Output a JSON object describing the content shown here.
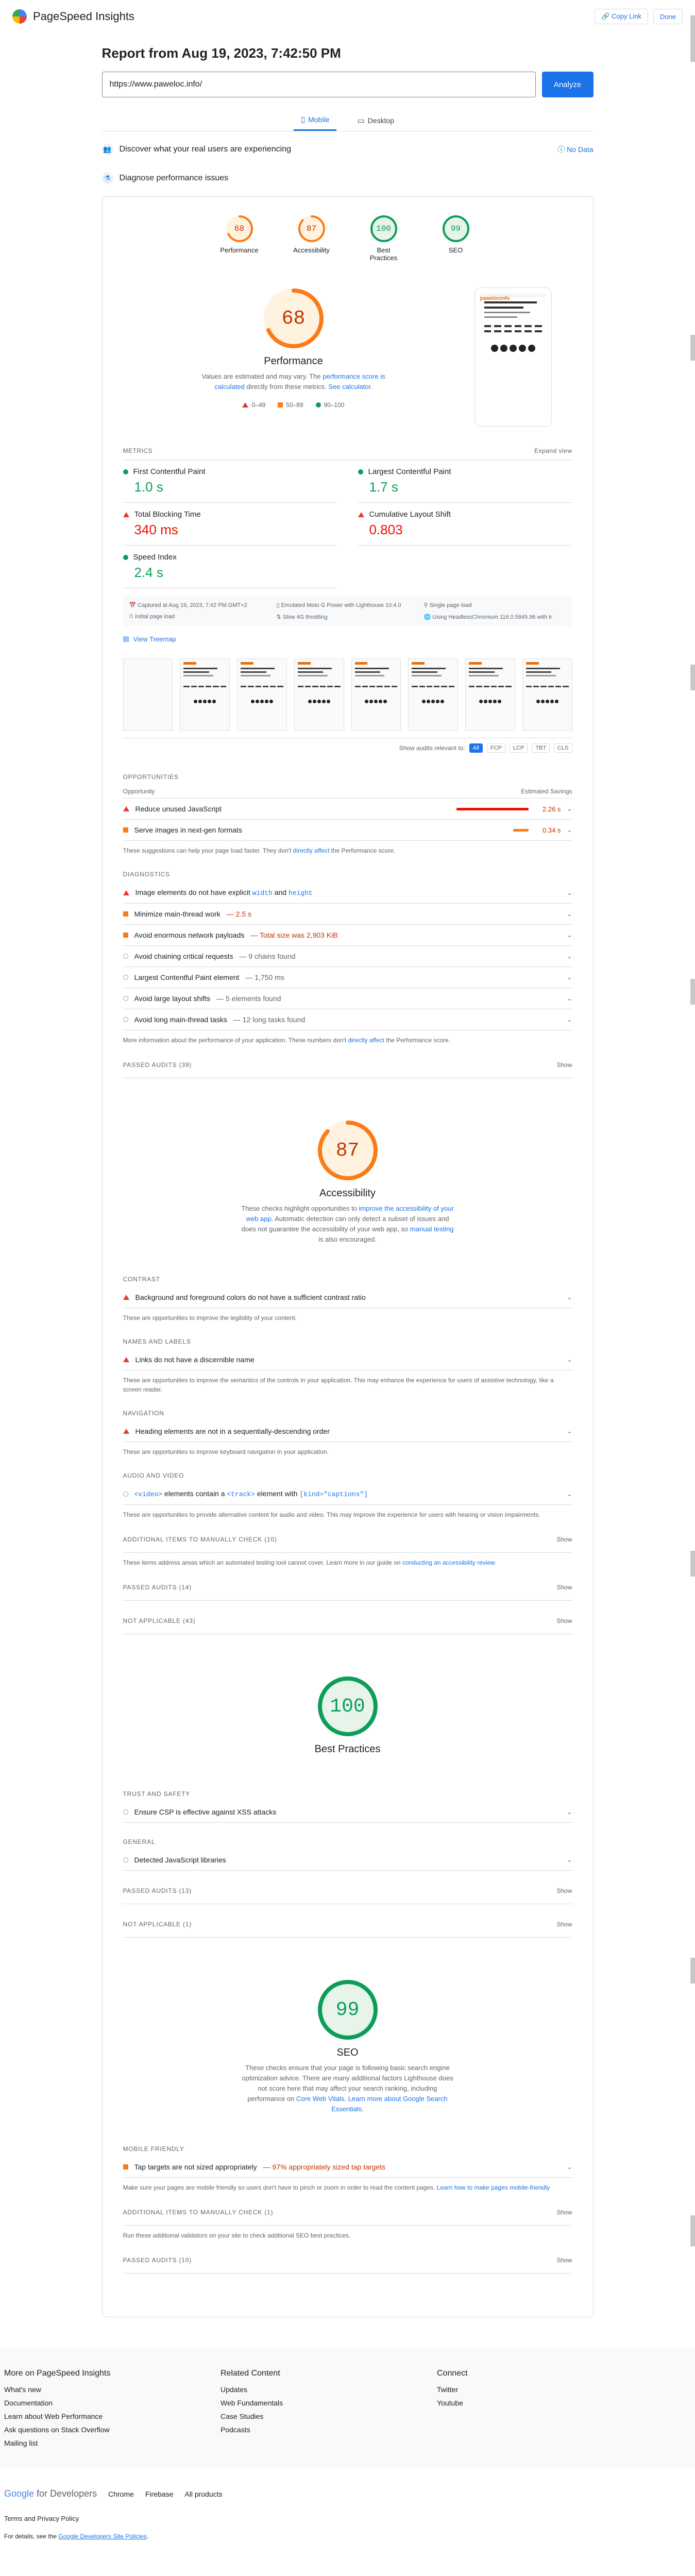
{
  "app": {
    "title": "PageSpeed Insights",
    "copy_link": "Copy Link",
    "done": "Done"
  },
  "report": {
    "title": "Report from Aug 19, 2023, 7:42:50 PM",
    "url": "https://www.paweloc.info/",
    "analyze": "Analyze"
  },
  "tabs": [
    {
      "label": "Mobile"
    },
    {
      "label": "Desktop"
    }
  ],
  "field": {
    "label": "Discover what your real users are experiencing",
    "no_data": "No Data"
  },
  "diagnose": {
    "label": "Diagnose performance issues"
  },
  "scores": [
    {
      "name": "Performance",
      "value": "68",
      "color": "#fa7b17"
    },
    {
      "name": "Accessibility",
      "value": "87",
      "color": "#fa7b17"
    },
    {
      "name": "Best Practices",
      "value": "100",
      "color": "#0c9d58"
    },
    {
      "name": "SEO",
      "value": "99",
      "color": "#0c9d58"
    }
  ],
  "perf": {
    "title": "Performance",
    "desc1": "Values are estimated and may vary. The ",
    "link1": "performance score is calculated",
    "desc2": " directly from these metrics. ",
    "link2": "See calculator.",
    "legend": [
      "0–49",
      "50–89",
      "90–100"
    ]
  },
  "metrics": {
    "label": "METRICS",
    "expand": "Expand view",
    "items": [
      {
        "name": "First Contentful Paint",
        "value": "1.0 s",
        "status": "good"
      },
      {
        "name": "Largest Contentful Paint",
        "value": "1.7 s",
        "status": "good"
      },
      {
        "name": "Total Blocking Time",
        "value": "340 ms",
        "status": "bad"
      },
      {
        "name": "Cumulative Layout Shift",
        "value": "0.803",
        "status": "bad"
      },
      {
        "name": "Speed Index",
        "value": "2.4 s",
        "status": "good"
      }
    ]
  },
  "info": [
    "Captured at Aug 19, 2023, 7:42 PM GMT+2",
    "Emulated Moto G Power with Lighthouse 10.4.0",
    "Single page load",
    "Initial page load",
    "Slow 4G throttling",
    "Using HeadlessChromium 116.0.5845.96 with lr"
  ],
  "view_treemap": "View Treemap",
  "show_audits": {
    "label": "Show audits relevant to:",
    "chips": [
      "All",
      "FCP",
      "LCP",
      "TBT",
      "CLS"
    ]
  },
  "opportunities": {
    "title": "OPPORTUNITIES",
    "col1": "Opportunity",
    "col2": "Estimated Savings",
    "items": [
      {
        "label": "Reduce unused JavaScript",
        "saving": "2.26 s"
      },
      {
        "label": "Serve images in next-gen formats",
        "saving": "0.34 s"
      }
    ],
    "hint1": "These suggestions can help your page load faster. They don't ",
    "hint_link": "directly affect",
    "hint2": " the Performance score."
  },
  "diagnostics": {
    "title": "DIAGNOSTICS",
    "items": [
      {
        "label": "Image elements do not have explicit ",
        "c1": "width",
        "mid": " and ",
        "c2": "height"
      },
      {
        "label": "Minimize main-thread work",
        "note": " — 2.5 s"
      },
      {
        "label": "Avoid enormous network payloads",
        "note": " — Total size was 2,903 KiB"
      },
      {
        "label": "Avoid chaining critical requests",
        "note": " — 9 chains found"
      },
      {
        "label": "Largest Contentful Paint element",
        "note": " — 1,750 ms"
      },
      {
        "label": "Avoid large layout shifts",
        "note": " — 5 elements found"
      },
      {
        "label": "Avoid long main-thread tasks",
        "note": " — 12 long tasks found"
      }
    ],
    "hint1": "More information about the performance of your application. These numbers don't ",
    "hint_link": "directly affect",
    "hint2": " the Performance score."
  },
  "passed_perf": {
    "label": "PASSED AUDITS",
    "count": "(39)",
    "show": "Show"
  },
  "a11y": {
    "title": "Accessibility",
    "desc1": "These checks highlight opportunities to ",
    "link1": "improve the accessibility of your web app",
    "desc2": ". Automatic detection can only detect a subset of issues and does not guarantee the accessibility of your web app, so ",
    "link2": "manual testing",
    "desc3": " is also encouraged.",
    "groups": [
      {
        "title": "CONTRAST",
        "item": "Background and foreground colors do not have a sufficient contrast ratio",
        "hint": "These are opportunities to improve the legibility of your content."
      },
      {
        "title": "NAMES AND LABELS",
        "item": "Links do not have a discernible name",
        "hint": "These are opportunities to improve the semantics of the controls in your application. This may enhance the experience for users of assistive technology, like a screen reader."
      },
      {
        "title": "NAVIGATION",
        "item": "Heading elements are not in a sequentially-descending order",
        "hint": "These are opportunities to improve keyboard navigation in your application."
      }
    ],
    "av_title": "AUDIO AND VIDEO",
    "av_c1": "<video>",
    "av_mid": " elements contain a ",
    "av_c2": "<track>",
    "av_mid2": " element with ",
    "av_c3": "[kind=\"captions\"]",
    "av_hint": "These are opportunities to provide alternative content for audio and video. This may improve the experience for users with hearing or vision impairments.",
    "manual_label": "ADDITIONAL ITEMS TO MANUALLY CHECK",
    "manual_count": "(10)",
    "manual_hint1": "These items address areas which an automated testing tool cannot cover. Learn more in our guide on ",
    "manual_link": "conducting an accessibility review",
    "passed_count": "(14)",
    "na_label": "NOT APPLICABLE",
    "na_count": "(43)"
  },
  "bp": {
    "title": "Best Practices",
    "trust": "TRUST AND SAFETY",
    "trust_item": "Ensure CSP is effective against XSS attacks",
    "general": "GENERAL",
    "general_item": "Detected JavaScript libraries",
    "passed_count": "(13)",
    "na_count": "(1)"
  },
  "seo": {
    "title": "SEO",
    "desc1": "These checks ensure that your page is following basic search engine optimization advice. There are many additional factors Lighthouse does not score here that may affect your search ranking, including performance on ",
    "link1": "Core Web Vitals",
    "desc2": ". ",
    "link2": "Learn more about Google Search Essentials",
    "desc3": ".",
    "mobile": "MOBILE FRIENDLY",
    "mobile_item": "Tap targets are not sized appropriately",
    "mobile_note": " — 97% appropriately sized tap targets",
    "mobile_hint": "Make sure your pages are mobile friendly so users don't have to pinch or zoom in order to read the content pages. ",
    "mobile_link": "Learn how to make pages mobile-friendly",
    "manual_count": "(1)",
    "manual_hint": "Run these additional validators on your site to check additional SEO best practices.",
    "passed_count": "(10)"
  },
  "footer": {
    "col1": {
      "title": "More on PageSpeed Insights",
      "links": [
        "What's new",
        "Documentation",
        "Learn about Web Performance",
        "Ask questions on Stack Overflow",
        "Mailing list"
      ]
    },
    "col2": {
      "title": "Related Content",
      "links": [
        "Updates",
        "Web Fundamentals",
        "Case Studies",
        "Podcasts"
      ]
    },
    "col3": {
      "title": "Connect",
      "links": [
        "Twitter",
        "Youtube"
      ]
    },
    "brand_g": "Google",
    "brand_rest": " for Developers",
    "bar_links": [
      "Chrome",
      "Firebase",
      "All products"
    ],
    "terms": "Terms and Privacy Policy",
    "details1": "For details, see the ",
    "details_link": "Google Developers Site Policies",
    "details2": "."
  }
}
